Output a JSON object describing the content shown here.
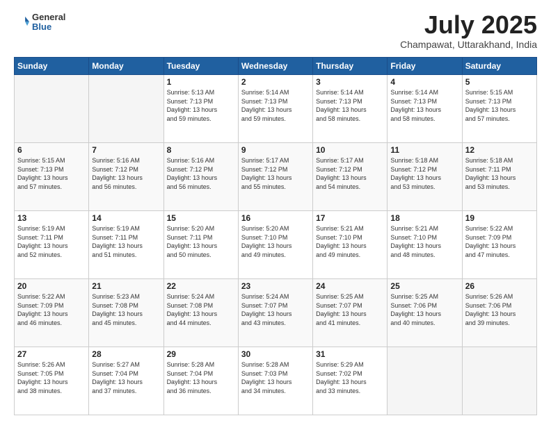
{
  "header": {
    "logo_general": "General",
    "logo_blue": "Blue",
    "month_title": "July 2025",
    "location": "Champawat, Uttarakhand, India"
  },
  "weekdays": [
    "Sunday",
    "Monday",
    "Tuesday",
    "Wednesday",
    "Thursday",
    "Friday",
    "Saturday"
  ],
  "weeks": [
    [
      {
        "day": "",
        "info": ""
      },
      {
        "day": "",
        "info": ""
      },
      {
        "day": "1",
        "info": "Sunrise: 5:13 AM\nSunset: 7:13 PM\nDaylight: 13 hours\nand 59 minutes."
      },
      {
        "day": "2",
        "info": "Sunrise: 5:14 AM\nSunset: 7:13 PM\nDaylight: 13 hours\nand 59 minutes."
      },
      {
        "day": "3",
        "info": "Sunrise: 5:14 AM\nSunset: 7:13 PM\nDaylight: 13 hours\nand 58 minutes."
      },
      {
        "day": "4",
        "info": "Sunrise: 5:14 AM\nSunset: 7:13 PM\nDaylight: 13 hours\nand 58 minutes."
      },
      {
        "day": "5",
        "info": "Sunrise: 5:15 AM\nSunset: 7:13 PM\nDaylight: 13 hours\nand 57 minutes."
      }
    ],
    [
      {
        "day": "6",
        "info": "Sunrise: 5:15 AM\nSunset: 7:13 PM\nDaylight: 13 hours\nand 57 minutes."
      },
      {
        "day": "7",
        "info": "Sunrise: 5:16 AM\nSunset: 7:12 PM\nDaylight: 13 hours\nand 56 minutes."
      },
      {
        "day": "8",
        "info": "Sunrise: 5:16 AM\nSunset: 7:12 PM\nDaylight: 13 hours\nand 56 minutes."
      },
      {
        "day": "9",
        "info": "Sunrise: 5:17 AM\nSunset: 7:12 PM\nDaylight: 13 hours\nand 55 minutes."
      },
      {
        "day": "10",
        "info": "Sunrise: 5:17 AM\nSunset: 7:12 PM\nDaylight: 13 hours\nand 54 minutes."
      },
      {
        "day": "11",
        "info": "Sunrise: 5:18 AM\nSunset: 7:12 PM\nDaylight: 13 hours\nand 53 minutes."
      },
      {
        "day": "12",
        "info": "Sunrise: 5:18 AM\nSunset: 7:11 PM\nDaylight: 13 hours\nand 53 minutes."
      }
    ],
    [
      {
        "day": "13",
        "info": "Sunrise: 5:19 AM\nSunset: 7:11 PM\nDaylight: 13 hours\nand 52 minutes."
      },
      {
        "day": "14",
        "info": "Sunrise: 5:19 AM\nSunset: 7:11 PM\nDaylight: 13 hours\nand 51 minutes."
      },
      {
        "day": "15",
        "info": "Sunrise: 5:20 AM\nSunset: 7:11 PM\nDaylight: 13 hours\nand 50 minutes."
      },
      {
        "day": "16",
        "info": "Sunrise: 5:20 AM\nSunset: 7:10 PM\nDaylight: 13 hours\nand 49 minutes."
      },
      {
        "day": "17",
        "info": "Sunrise: 5:21 AM\nSunset: 7:10 PM\nDaylight: 13 hours\nand 49 minutes."
      },
      {
        "day": "18",
        "info": "Sunrise: 5:21 AM\nSunset: 7:10 PM\nDaylight: 13 hours\nand 48 minutes."
      },
      {
        "day": "19",
        "info": "Sunrise: 5:22 AM\nSunset: 7:09 PM\nDaylight: 13 hours\nand 47 minutes."
      }
    ],
    [
      {
        "day": "20",
        "info": "Sunrise: 5:22 AM\nSunset: 7:09 PM\nDaylight: 13 hours\nand 46 minutes."
      },
      {
        "day": "21",
        "info": "Sunrise: 5:23 AM\nSunset: 7:08 PM\nDaylight: 13 hours\nand 45 minutes."
      },
      {
        "day": "22",
        "info": "Sunrise: 5:24 AM\nSunset: 7:08 PM\nDaylight: 13 hours\nand 44 minutes."
      },
      {
        "day": "23",
        "info": "Sunrise: 5:24 AM\nSunset: 7:07 PM\nDaylight: 13 hours\nand 43 minutes."
      },
      {
        "day": "24",
        "info": "Sunrise: 5:25 AM\nSunset: 7:07 PM\nDaylight: 13 hours\nand 41 minutes."
      },
      {
        "day": "25",
        "info": "Sunrise: 5:25 AM\nSunset: 7:06 PM\nDaylight: 13 hours\nand 40 minutes."
      },
      {
        "day": "26",
        "info": "Sunrise: 5:26 AM\nSunset: 7:06 PM\nDaylight: 13 hours\nand 39 minutes."
      }
    ],
    [
      {
        "day": "27",
        "info": "Sunrise: 5:26 AM\nSunset: 7:05 PM\nDaylight: 13 hours\nand 38 minutes."
      },
      {
        "day": "28",
        "info": "Sunrise: 5:27 AM\nSunset: 7:04 PM\nDaylight: 13 hours\nand 37 minutes."
      },
      {
        "day": "29",
        "info": "Sunrise: 5:28 AM\nSunset: 7:04 PM\nDaylight: 13 hours\nand 36 minutes."
      },
      {
        "day": "30",
        "info": "Sunrise: 5:28 AM\nSunset: 7:03 PM\nDaylight: 13 hours\nand 34 minutes."
      },
      {
        "day": "31",
        "info": "Sunrise: 5:29 AM\nSunset: 7:02 PM\nDaylight: 13 hours\nand 33 minutes."
      },
      {
        "day": "",
        "info": ""
      },
      {
        "day": "",
        "info": ""
      }
    ]
  ]
}
